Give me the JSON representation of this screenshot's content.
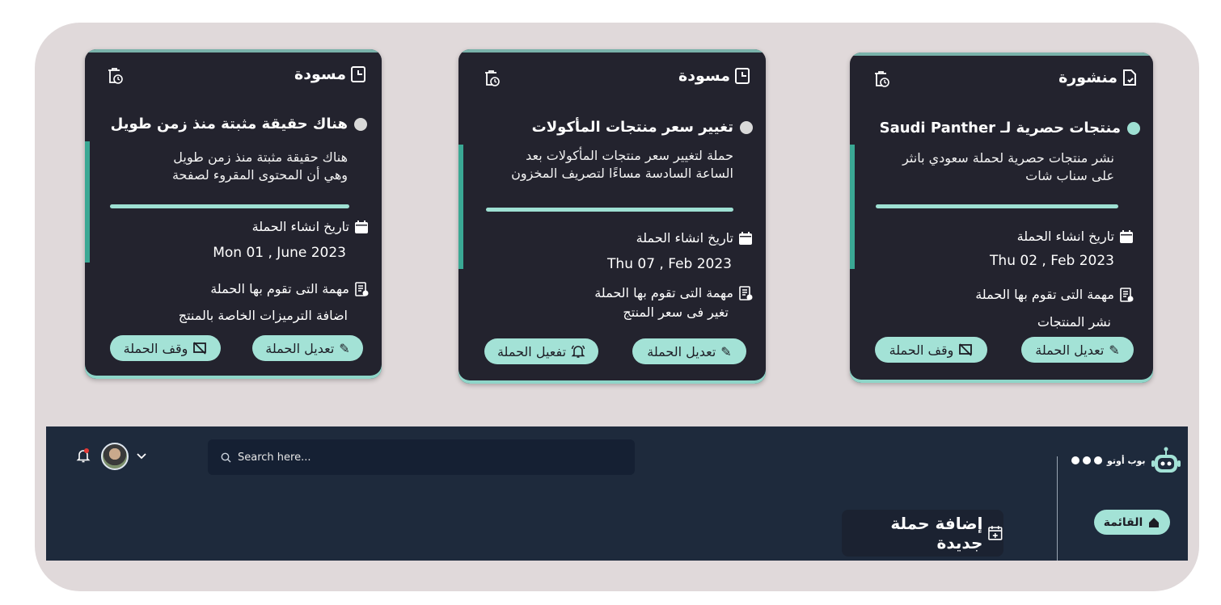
{
  "cards": [
    {
      "status": "منشورة",
      "title": "منتجات حصرية لـ Saudi Panther",
      "description": "نشر منتجات حصرية لحملة سعودي بانثر\nعلى سناب شات",
      "created_label": "تاريخ انشاء الحملة",
      "created_date": "Thu 02 , Feb 2023",
      "task_label": "مهمة التى تقوم بها الحملة",
      "task_value": "نشر  المنتجات",
      "edit_label": "تعديل الحملة",
      "action_label": "وقف الحملة",
      "dot_color": "#9ee0d3"
    },
    {
      "status": "مسودة",
      "title": "تغيير سعر منتجات المأكولات",
      "description": "حملة لتغيير سعر منتجات المأكولات بعد\nالساعة السادسة مساءًا لتصريف المخزون",
      "created_label": "تاريخ انشاء الحملة",
      "created_date": "Thu 07 , Feb 2023",
      "task_label": "مهمة التى تقوم بها الحملة",
      "task_value": "تغير فى سعر المنتج",
      "edit_label": "تعديل الحملة",
      "action_label": "تفعيل الحملة",
      "dot_color": "#d9d9d9"
    },
    {
      "status": "مسودة",
      "title": "هناك حقيقة مثبتة منذ زمن طويل",
      "description": "هناك حقيقة مثبتة منذ زمن طويل\nوهي أن المحتوى المقروء لصفحة",
      "created_label": "تاريخ انشاء الحملة",
      "created_date": "Mon 01 , June 2023",
      "task_label": "مهمة التى تقوم بها الحملة",
      "task_value": "اضافة الترميزات الخاصة بالمنتج",
      "edit_label": "تعديل الحملة",
      "action_label": "وقف الحملة",
      "dot_color": "#d9d9d9"
    }
  ],
  "header": {
    "search_placeholder": "Search here...",
    "brand": "بوب أوتو",
    "add_campaign": "إضافة حملة جديدة",
    "menu_label": "القائمة"
  },
  "colors": {
    "accent": "#a3e2d6",
    "card_bg": "#23232e",
    "bar_bg": "#1e2a3c",
    "notification": "#e53935"
  }
}
